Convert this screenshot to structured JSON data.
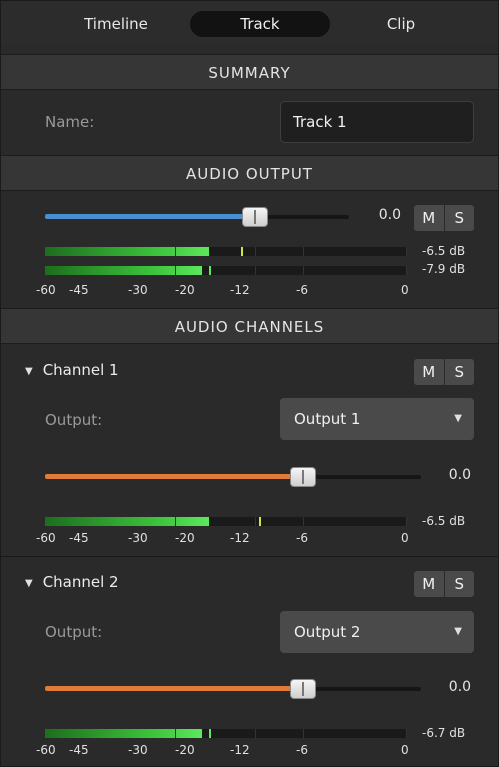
{
  "tabs": [
    "Timeline",
    "Track",
    "Clip"
  ],
  "summary": {
    "header": "SUMMARY",
    "name_label": "Name:",
    "name_value": "Track 1"
  },
  "audio_output": {
    "header": "AUDIO OUTPUT",
    "volume_value": "0.0",
    "volume_fraction": 0.7,
    "mute": "M",
    "solo": "S",
    "meter_left_db": "-6.5 dB",
    "meter_right_db": "-7.9 dB",
    "scale": [
      "-60",
      "-45",
      "-30",
      "-20",
      "-12",
      "-6",
      "0"
    ]
  },
  "audio_channels": {
    "header": "AUDIO CHANNELS",
    "channels": [
      {
        "name": "Channel 1",
        "mute": "M",
        "solo": "S",
        "output_label": "Output:",
        "output_value": "Output 1",
        "volume_value": "0.0",
        "meter_db": "-6.5 dB",
        "scale": [
          "-60",
          "-45",
          "-30",
          "-20",
          "-12",
          "-6",
          "0"
        ]
      },
      {
        "name": "Channel 2",
        "mute": "M",
        "solo": "S",
        "output_label": "Output:",
        "output_value": "Output 2",
        "volume_value": "0.0",
        "meter_db": "-6.7 dB",
        "scale": [
          "-60",
          "-45",
          "-30",
          "-20",
          "-12",
          "-6",
          "0"
        ]
      }
    ]
  },
  "colors": {
    "output_slider": "#4a8fd0",
    "channel_slider": "#e07b39",
    "meter_green": "#3dc53d",
    "peak_yellow": "#d6e04a"
  },
  "icons": {
    "collapse": "triangle-down-icon",
    "dropdown": "caret-down-icon"
  }
}
